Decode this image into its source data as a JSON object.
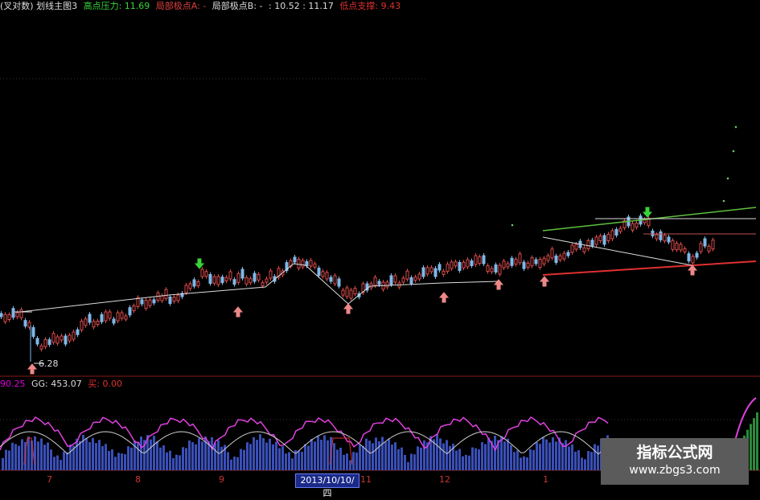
{
  "legend": {
    "indicator_name": "(叉对数) 划线主图3",
    "high_label": "高点压力: 11.69",
    "local_a": "局部极点A: -",
    "local_b": "局部极点B: -",
    "range_text": ": 10.52 : 11.17",
    "low_label": "低点支撑: 9.43",
    "colors": {
      "high": "#39d439",
      "low": "#e03030",
      "text": "#dddddd"
    }
  },
  "main_annotation": "6.28",
  "sub_legend": {
    "value1": "90.25",
    "gg": "GG: 453.07",
    "buy": "买: 0.00"
  },
  "axis_months": [
    "7",
    "8",
    "9",
    "11",
    "12",
    "1"
  ],
  "crosshair_date": "2013/10/10/四",
  "watermark": {
    "title": "指标公式网",
    "url": "www.zbgs3.com"
  },
  "chart_data": {
    "type": "candlestick",
    "price_min": 6.28,
    "price_high_pressure": 11.69,
    "price_low_support": 9.43,
    "markers": {
      "down_arrows": 2,
      "up_arrows": 7
    }
  }
}
